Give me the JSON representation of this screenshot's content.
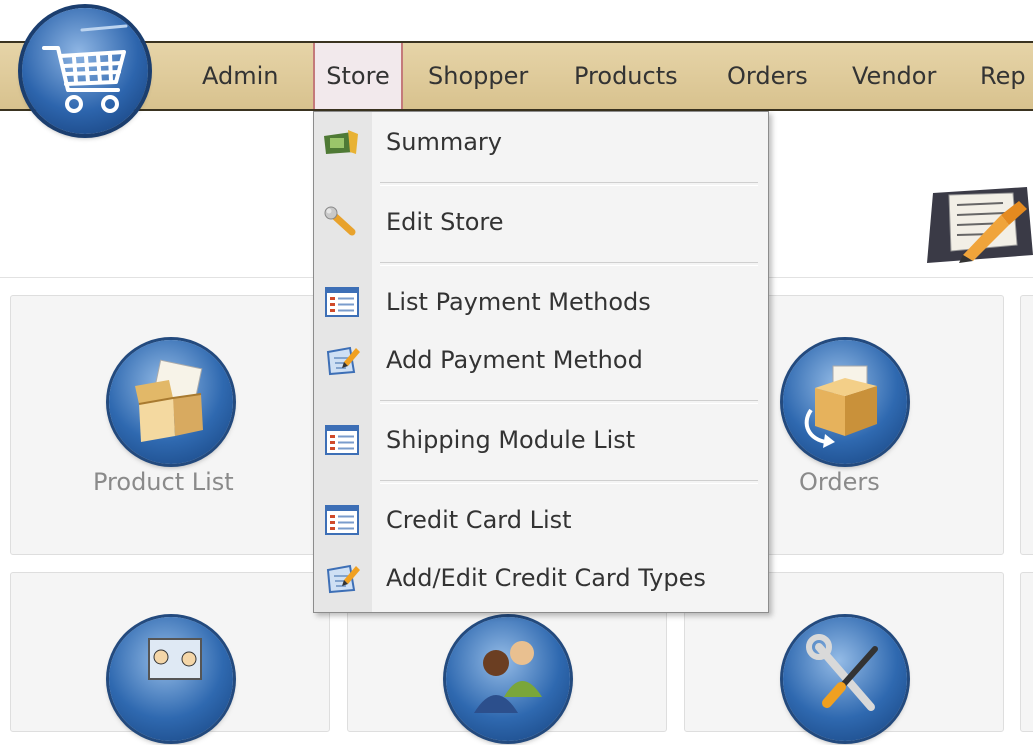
{
  "menu": {
    "items": [
      "Admin",
      "Store",
      "Shopper",
      "Products",
      "Orders",
      "Vendor",
      "Rep"
    ],
    "active": "Store"
  },
  "dropdown": {
    "items": [
      {
        "label": "Summary",
        "icon": "summary-icon"
      },
      {
        "label": "Edit Store",
        "icon": "wrench-icon"
      },
      {
        "label": "List Payment Methods",
        "icon": "list-icon"
      },
      {
        "label": "Add Payment Method",
        "icon": "edit-note-icon"
      },
      {
        "label": "Shipping Module List",
        "icon": "list-icon"
      },
      {
        "label": "Credit Card List",
        "icon": "list-icon"
      },
      {
        "label": "Add/Edit Credit Card Types",
        "icon": "edit-note-icon"
      }
    ]
  },
  "panels": [
    {
      "label": "Product List",
      "icon": "product-box-icon"
    },
    {
      "label": "Orders",
      "icon": "orders-box-icon"
    }
  ],
  "colors": {
    "menubar": "#dcc794",
    "active_bg": "#f2e9ec",
    "icon_blue": "#2f69b0"
  }
}
